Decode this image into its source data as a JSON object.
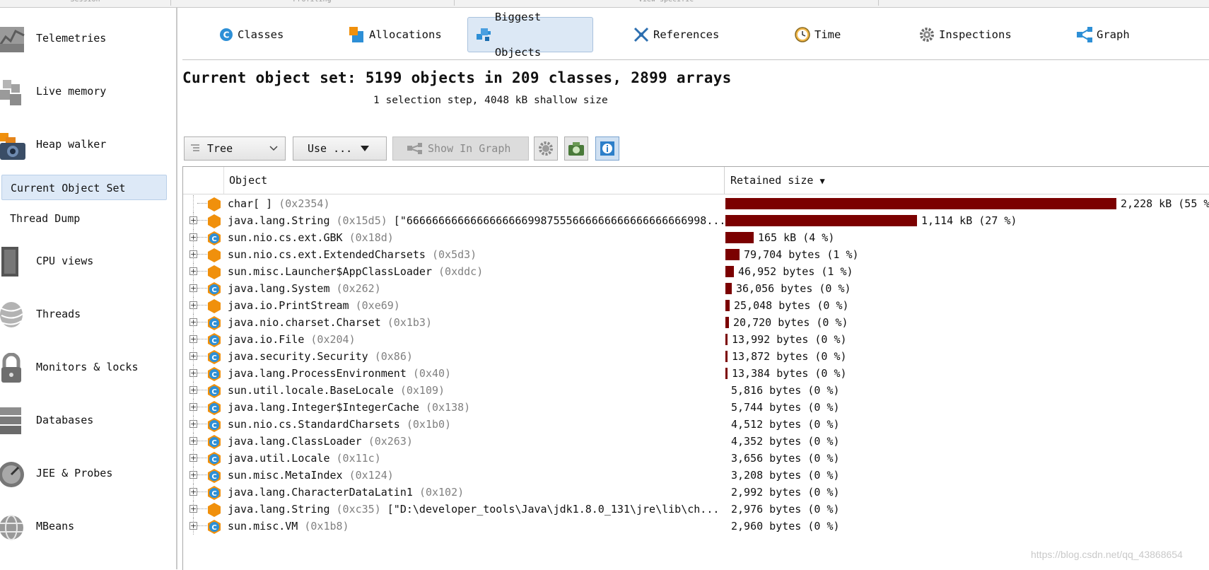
{
  "top_sections": [
    "Session",
    "Profiling",
    "View specific"
  ],
  "sidebar": {
    "items": [
      {
        "label": "Telemetries",
        "icon": "telemetries-icon"
      },
      {
        "label": "Live memory",
        "icon": "live-memory-icon"
      },
      {
        "label": "Heap walker",
        "icon": "heap-walker-icon"
      },
      {
        "label": "CPU views",
        "icon": "cpu-views-icon"
      },
      {
        "label": "Threads",
        "icon": "threads-icon"
      },
      {
        "label": "Monitors & locks",
        "icon": "monitors-locks-icon"
      },
      {
        "label": "Databases",
        "icon": "databases-icon"
      },
      {
        "label": "JEE & Probes",
        "icon": "jee-probes-icon"
      },
      {
        "label": "MBeans",
        "icon": "mbeans-icon"
      }
    ],
    "subitems": [
      {
        "label": "Current Object Set",
        "active": true
      },
      {
        "label": "Thread Dump",
        "active": false
      }
    ]
  },
  "tabs": [
    {
      "label": "Classes",
      "icon": "classes-icon",
      "active": false
    },
    {
      "label": "Allocations",
      "icon": "allocations-icon",
      "active": false
    },
    {
      "label": "Biggest Objects",
      "icon": "biggest-objects-icon",
      "active": true
    },
    {
      "label": "References",
      "icon": "references-icon",
      "active": false
    },
    {
      "label": "Time",
      "icon": "time-icon",
      "active": false
    },
    {
      "label": "Inspections",
      "icon": "inspections-icon",
      "active": false
    },
    {
      "label": "Graph",
      "icon": "graph-icon",
      "active": false
    }
  ],
  "header": {
    "title": "Current object set: 5199 objects in 209 classes, 2899 arrays",
    "subtitle": "1 selection step, 4048 kB shallow size"
  },
  "toolbar": {
    "view_mode": "Tree",
    "use_label": "Use ...",
    "show_in_graph": "Show In Graph"
  },
  "table": {
    "columns": [
      "Object",
      "Retained size"
    ],
    "sort_indicator": "▼",
    "rows": [
      {
        "name": "char[ ]",
        "addr": "(0x2354)",
        "extra": "",
        "size": "2,228 kB (55 %",
        "fraction": 0.55,
        "kind": "array",
        "expandable": false
      },
      {
        "name": "java.lang.String",
        "addr": "(0x15d5)",
        "extra": "[\"66666666666666666669987555666666666666666666998...",
        "size": "1,114 kB (27 %)",
        "fraction": 0.27,
        "kind": "object",
        "expandable": true
      },
      {
        "name": "sun.nio.cs.ext.GBK",
        "addr": "(0x18d)",
        "extra": "",
        "size": "165 kB (4 %)",
        "fraction": 0.04,
        "kind": "class",
        "expandable": true
      },
      {
        "name": "sun.nio.cs.ext.ExtendedCharsets",
        "addr": "(0x5d3)",
        "extra": "",
        "size": "79,704 bytes (1 %)",
        "fraction": 0.0196,
        "kind": "object",
        "expandable": true
      },
      {
        "name": "sun.misc.Launcher$AppClassLoader",
        "addr": "(0xddc)",
        "extra": "",
        "size": "46,952 bytes (1 %)",
        "fraction": 0.0115,
        "kind": "object",
        "expandable": true
      },
      {
        "name": "java.lang.System",
        "addr": "(0x262)",
        "extra": "",
        "size": "36,056 bytes (0 %)",
        "fraction": 0.0088,
        "kind": "class",
        "expandable": true
      },
      {
        "name": "java.io.PrintStream",
        "addr": "(0xe69)",
        "extra": "",
        "size": "25,048 bytes (0 %)",
        "fraction": 0.0061,
        "kind": "object",
        "expandable": true
      },
      {
        "name": "java.nio.charset.Charset",
        "addr": "(0x1b3)",
        "extra": "",
        "size": "20,720 bytes (0 %)",
        "fraction": 0.0051,
        "kind": "class",
        "expandable": true
      },
      {
        "name": "java.io.File",
        "addr": "(0x204)",
        "extra": "",
        "size": "13,992 bytes (0 %)",
        "fraction": 0.0034,
        "kind": "class",
        "expandable": true
      },
      {
        "name": "java.security.Security",
        "addr": "(0x86)",
        "extra": "",
        "size": "13,872 bytes (0 %)",
        "fraction": 0.0034,
        "kind": "class",
        "expandable": true
      },
      {
        "name": "java.lang.ProcessEnvironment",
        "addr": "(0x40)",
        "extra": "",
        "size": "13,384 bytes (0 %)",
        "fraction": 0.0033,
        "kind": "class",
        "expandable": true
      },
      {
        "name": "sun.util.locale.BaseLocale",
        "addr": "(0x109)",
        "extra": "",
        "size": "5,816 bytes (0 %)",
        "fraction": 0,
        "kind": "class",
        "expandable": true
      },
      {
        "name": "java.lang.Integer$IntegerCache",
        "addr": "(0x138)",
        "extra": "",
        "size": "5,744 bytes (0 %)",
        "fraction": 0,
        "kind": "class",
        "expandable": true
      },
      {
        "name": "sun.nio.cs.StandardCharsets",
        "addr": "(0x1b0)",
        "extra": "",
        "size": "4,512 bytes (0 %)",
        "fraction": 0,
        "kind": "class",
        "expandable": true
      },
      {
        "name": "java.lang.ClassLoader",
        "addr": "(0x263)",
        "extra": "",
        "size": "4,352 bytes (0 %)",
        "fraction": 0,
        "kind": "class",
        "expandable": true
      },
      {
        "name": "java.util.Locale",
        "addr": "(0x11c)",
        "extra": "",
        "size": "3,656 bytes (0 %)",
        "fraction": 0,
        "kind": "class",
        "expandable": true
      },
      {
        "name": "sun.misc.MetaIndex",
        "addr": "(0x124)",
        "extra": "",
        "size": "3,208 bytes (0 %)",
        "fraction": 0,
        "kind": "class",
        "expandable": true
      },
      {
        "name": "java.lang.CharacterDataLatin1",
        "addr": "(0x102)",
        "extra": "",
        "size": "2,992 bytes (0 %)",
        "fraction": 0,
        "kind": "class",
        "expandable": true
      },
      {
        "name": "java.lang.String",
        "addr": "(0xc35)",
        "extra": "[\"D:\\developer_tools\\Java\\jdk1.8.0_131\\jre\\lib\\ch...",
        "size": "2,976 bytes (0 %)",
        "fraction": 0,
        "kind": "object",
        "expandable": true
      },
      {
        "name": "sun.misc.VM",
        "addr": "(0x1b8)",
        "extra": "",
        "size": "2,960 bytes (0 %)",
        "fraction": 0,
        "kind": "class",
        "expandable": true
      }
    ]
  },
  "colors": {
    "bar": "#7b0000",
    "object_icon": "#f0900c",
    "class_icon": "#2d8fd6",
    "active_bg": "#dce8f5"
  },
  "watermark": "https://blog.csdn.net/qq_43868654"
}
